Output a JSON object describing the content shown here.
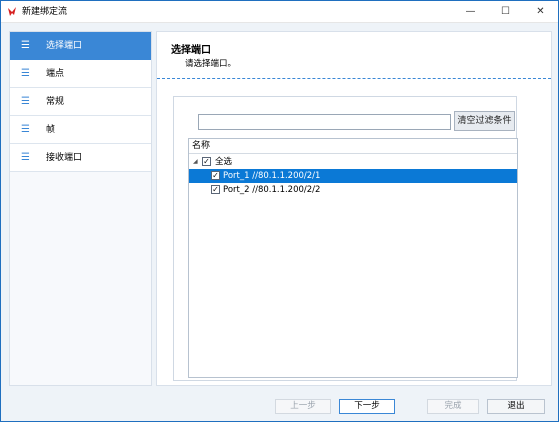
{
  "window": {
    "title": "新建绑定流",
    "minimize_glyph": "—",
    "maximize_glyph": "☐",
    "close_glyph": "✕",
    "accent": "#3a87d6"
  },
  "sidebar": {
    "items": [
      {
        "label": "选择端口",
        "icon": "list-icon",
        "glyph": "☰",
        "active": true
      },
      {
        "label": "端点",
        "icon": "list-icon",
        "glyph": "☰",
        "active": false
      },
      {
        "label": "常规",
        "icon": "list-icon",
        "glyph": "☰",
        "active": false
      },
      {
        "label": "帧",
        "icon": "list-icon",
        "glyph": "☰",
        "active": false
      },
      {
        "label": "接收端口",
        "icon": "list-icon",
        "glyph": "☰",
        "active": false
      }
    ]
  },
  "main": {
    "title": "选择端口",
    "subtitle": "请选择端口。",
    "filter": {
      "value": "",
      "placeholder": "",
      "clear_label": "清空过滤条件"
    },
    "tree": {
      "header": "名称",
      "root": {
        "label": "全选",
        "checked": true,
        "expander": "◢"
      },
      "children": [
        {
          "label": "Port_1 //80.1.1.200/2/1",
          "checked": true,
          "selected": true
        },
        {
          "label": "Port_2 //80.1.1.200/2/2",
          "checked": true,
          "selected": false
        }
      ]
    }
  },
  "footer": {
    "prev_label": "上一步",
    "next_label": "下一步",
    "finish_label": "完成",
    "exit_label": "退出"
  }
}
